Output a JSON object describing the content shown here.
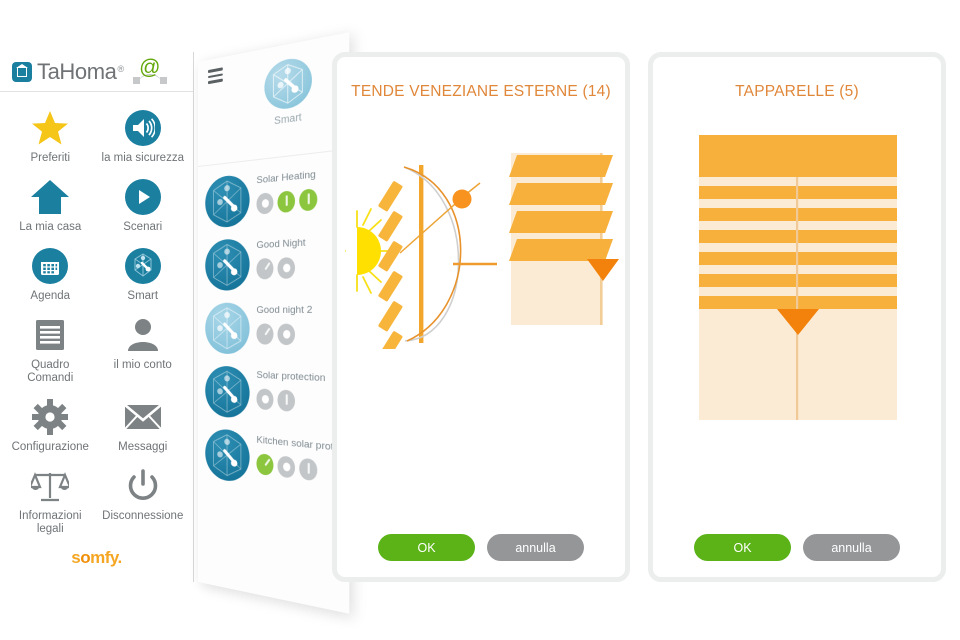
{
  "brand": {
    "name": "TaHoma",
    "registered": "®",
    "at_symbol": "@",
    "footer_logo": "somfy.",
    "footer_logo_o": "o"
  },
  "sidebar": {
    "items": [
      {
        "label": "Preferiti",
        "icon": "star-icon"
      },
      {
        "label": "la mia sicurezza",
        "icon": "speaker-icon"
      },
      {
        "label": "La mia casa",
        "icon": "house-icon"
      },
      {
        "label": "Scenari",
        "icon": "play-icon"
      },
      {
        "label": "Agenda",
        "icon": "calendar-icon"
      },
      {
        "label": "Smart",
        "icon": "network-icon"
      },
      {
        "label": "Quadro Comandi",
        "icon": "document-icon"
      },
      {
        "label": "il mio conto",
        "icon": "user-icon"
      },
      {
        "label": "Configurazione",
        "icon": "gear-icon"
      },
      {
        "label": "Messaggi",
        "icon": "envelope-icon"
      },
      {
        "label": "Informazioni legali",
        "icon": "scales-icon"
      },
      {
        "label": "Disconnessione",
        "icon": "power-icon"
      }
    ]
  },
  "scenario_panel": {
    "menu_icon": "hamburger-icon",
    "header_label": "Smart",
    "scenarios": [
      {
        "name": "Solar Heating",
        "tone": "dark",
        "dots": [
          "gray-ring",
          "green",
          "green"
        ]
      },
      {
        "name": "Good Night",
        "tone": "dark",
        "dots": [
          "gray-clock",
          "gray-ring"
        ]
      },
      {
        "name": "Good night 2",
        "tone": "light",
        "dots": [
          "gray-clock",
          "gray-ring"
        ]
      },
      {
        "name": "Solar protection",
        "tone": "dark",
        "dots": [
          "gray-ring",
          "gray"
        ]
      },
      {
        "name": "Kitchen solar protection",
        "tone": "dark",
        "dots": [
          "green-clock",
          "gray-ring",
          "gray"
        ]
      }
    ]
  },
  "blinds_card": {
    "title": "TENDE VENEZIANE ESTERNE (14)",
    "graphic": "venetian-blind-sun-angle",
    "ok_label": "OK",
    "cancel_label": "annulla"
  },
  "shutters_card": {
    "title": "TAPPARELLE (5)",
    "graphic": "roller-shutter",
    "ok_label": "OK",
    "cancel_label": "annulla"
  },
  "colors": {
    "brand_blue": "#1b7fa0",
    "accent_orange": "#f0a033",
    "title_orange": "#e0873a",
    "ok_green": "#5bb318",
    "cancel_gray": "#949698",
    "somfy_yellow": "#f5a623",
    "slat_fill": "#fbd39a",
    "panel_cream": "#fcebd4"
  }
}
